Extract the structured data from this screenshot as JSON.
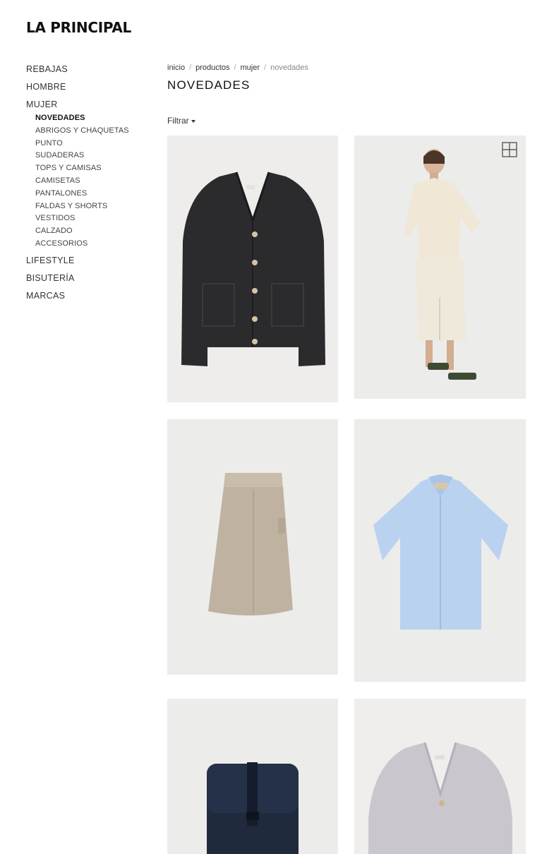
{
  "header": {
    "logo": "LA PRINCIPAL"
  },
  "sidebar": {
    "items": [
      {
        "label": "REBAJAS"
      },
      {
        "label": "HOMBRE"
      },
      {
        "label": "MUJER"
      },
      {
        "label": "LIFESTYLE"
      },
      {
        "label": "BISUTERÍA"
      },
      {
        "label": "MARCAS"
      }
    ],
    "mujer_sub": [
      {
        "label": "NOVEDADES",
        "active": true
      },
      {
        "label": "ABRIGOS Y CHAQUETAS"
      },
      {
        "label": "PUNTO"
      },
      {
        "label": "SUDADERAS"
      },
      {
        "label": "TOPS Y CAMISAS"
      },
      {
        "label": "CAMISETAS"
      },
      {
        "label": "PANTALONES"
      },
      {
        "label": "FALDAS Y SHORTS"
      },
      {
        "label": "VESTIDOS"
      },
      {
        "label": "CALZADO"
      },
      {
        "label": "ACCESORIOS"
      }
    ]
  },
  "breadcrumb": [
    "inicio",
    "productos",
    "mujer",
    "novedades"
  ],
  "page": {
    "title": "NOVEDADES",
    "filter_label": "Filtrar"
  },
  "products": [
    {
      "icon": "black-knit-cardigan-icon"
    },
    {
      "icon": "model-cream-shirt-skirt-icon"
    },
    {
      "icon": "beige-midi-skirt-icon"
    },
    {
      "icon": "light-blue-shirt-icon"
    },
    {
      "icon": "navy-backpack-icon"
    },
    {
      "icon": "grey-knit-cardigan-icon"
    }
  ],
  "colors": {
    "background": "#ffffff",
    "text": "#222222",
    "muted": "#888888"
  }
}
